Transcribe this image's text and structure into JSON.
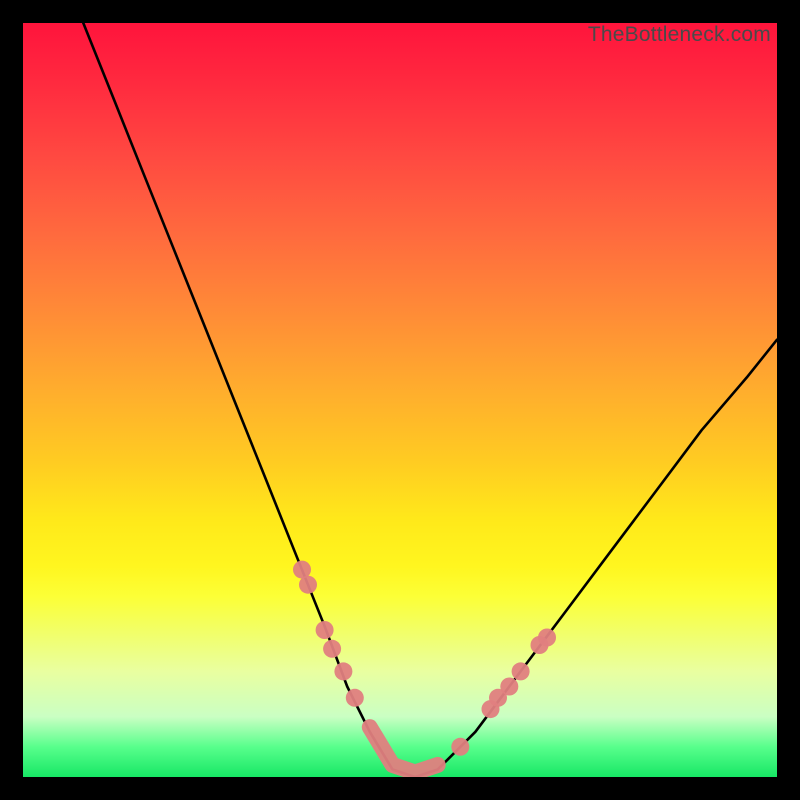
{
  "watermark": "TheBottleneck.com",
  "chart_data": {
    "type": "line",
    "title": "",
    "xlabel": "",
    "ylabel": "",
    "xlim": [
      0,
      100
    ],
    "ylim": [
      0,
      100
    ],
    "grid": false,
    "series": [
      {
        "name": "bottleneck-curve",
        "color": "#000000",
        "x": [
          8,
          12,
          16,
          20,
          24,
          28,
          32,
          36,
          40,
          43,
          46,
          49,
          52,
          55,
          60,
          66,
          72,
          78,
          84,
          90,
          96,
          100
        ],
        "y": [
          100,
          90,
          80,
          70,
          60,
          50,
          40,
          30,
          20,
          12,
          6,
          1,
          0,
          1,
          6,
          14,
          22,
          30,
          38,
          46,
          53,
          58
        ]
      }
    ],
    "markers": [
      {
        "name": "left-cluster-markers",
        "color": "#e08080",
        "points": [
          {
            "x": 37.0,
            "y": 27.5
          },
          {
            "x": 37.8,
            "y": 25.5
          },
          {
            "x": 40.0,
            "y": 19.5
          },
          {
            "x": 41.0,
            "y": 17.0
          },
          {
            "x": 42.5,
            "y": 14.0
          },
          {
            "x": 44.0,
            "y": 10.5
          }
        ]
      },
      {
        "name": "right-cluster-markers",
        "color": "#e08080",
        "points": [
          {
            "x": 58.0,
            "y": 4.0
          },
          {
            "x": 62.0,
            "y": 9.0
          },
          {
            "x": 63.0,
            "y": 10.5
          },
          {
            "x": 64.5,
            "y": 12.0
          },
          {
            "x": 66.0,
            "y": 14.0
          },
          {
            "x": 68.5,
            "y": 17.5
          },
          {
            "x": 69.5,
            "y": 18.5
          }
        ]
      }
    ],
    "valley_band": {
      "color": "#e08080",
      "x_start": 44,
      "x_end": 58,
      "y": 0.5
    }
  }
}
